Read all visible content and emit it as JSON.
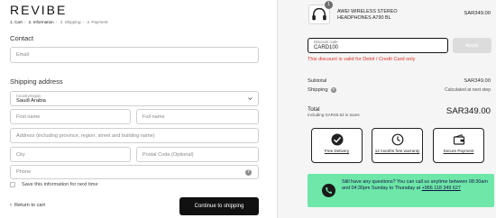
{
  "brand": "REVIBE",
  "breadcrumb": [
    {
      "label": "1. Cart",
      "active": true
    },
    {
      "label": "2. Information",
      "active": true
    },
    {
      "label": "3. Shipping",
      "active": false
    },
    {
      "label": "4. Payment",
      "active": false
    }
  ],
  "contact": {
    "title": "Contact",
    "email_placeholder": "Email"
  },
  "shipping": {
    "title": "Shipping address",
    "country_label": "Country/region",
    "country_value": "Saudi Arabia",
    "first_name_placeholder": "First name",
    "last_name_placeholder": "Full name",
    "address_placeholder": "Address (including province, region, street and building name)",
    "city_placeholder": "City",
    "postal_placeholder": "Postal Code (Optional)",
    "phone_placeholder": "Phone",
    "phone_help_glyph": "?",
    "save_info_label": "Save this information for next time",
    "save_info_checked": false
  },
  "footer": {
    "return_label": "Return to cart",
    "continue_label": "Continue to shipping"
  },
  "summary": {
    "product": {
      "name": "AWEI WIRELESS STEREO HEADPHONES A790 BL",
      "price": "SAR349.00",
      "quantity": "1",
      "icon": "headphones-icon"
    },
    "discount": {
      "label": "Discount code",
      "value": "CARD100",
      "apply_label": "Apply",
      "error": "This discount is valid for Debit / Credit Card only"
    },
    "subtotal_label": "Subtotal",
    "subtotal_value": "SAR349.00",
    "shipping_label": "Shipping",
    "shipping_help_glyph": "?",
    "shipping_value": "Calculated at next step",
    "total_label": "Total",
    "taxes_note": "Including SAR45.52 in taxes",
    "total_value": "SAR349.00"
  },
  "features": [
    {
      "label": "Free Delivery",
      "icon": "delivery-truck-icon"
    },
    {
      "label": "12 months free warranty",
      "icon": "warranty-clock-icon"
    },
    {
      "label": "Secure Payment",
      "icon": "secure-wallet-icon"
    }
  ],
  "help": {
    "line": "Still have any questions? You can call us anytime between 08:30am and 04:30pm Sunday to Thursday at",
    "phone": "+966 118 349 627",
    "icon": "phone-icon"
  },
  "colors": {
    "error": "#d9342b",
    "help_card_bg": "#6ee7a8",
    "primary_button": "#111111",
    "apply_disabled": "#dcdcdc"
  }
}
